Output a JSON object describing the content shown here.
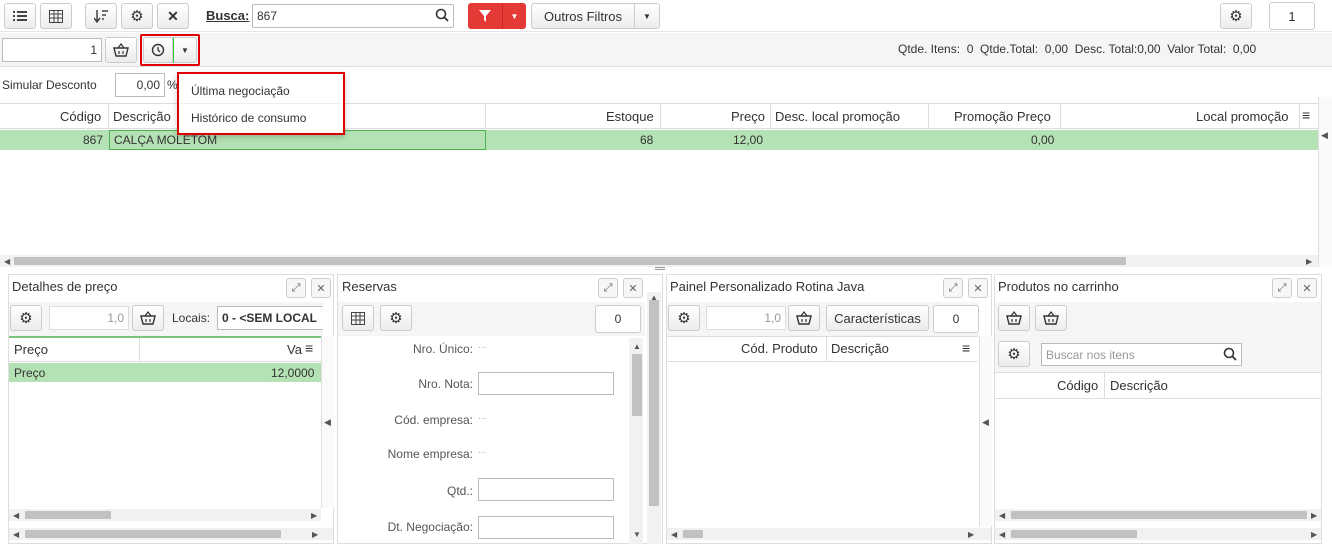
{
  "toolbar": {
    "search_label": "Busca:",
    "search_value": "867",
    "other_filters": "Outros Filtros",
    "page_number": "1",
    "quantity_value": "1"
  },
  "totals": {
    "text": "Qtde. Itens:  0  Qtde.Total:  0,00  Desc. Total:0,00  Valor Total:  0,00"
  },
  "discount": {
    "label": "Simular Desconto",
    "value": "0,00",
    "pct": "%"
  },
  "dropdown": {
    "items": [
      "Última negociação",
      "Histórico de consumo"
    ]
  },
  "grid": {
    "columns": [
      "Código",
      "Descrição",
      "Estoque",
      "Preço",
      "Desc. local promoção",
      "Promoção Preço",
      "Local promoção"
    ],
    "row": {
      "codigo": "867",
      "descricao": "CALÇA MOLETOM",
      "estoque": "68",
      "preco": "12,00",
      "desc_local": "",
      "promo_preco": "0,00",
      "local": ""
    }
  },
  "price_panel": {
    "title": "Detalhes de preço",
    "qty": "1,0",
    "locais_label": "Locais:",
    "locais_value": "0 - <SEM LOCAL",
    "col_preco": "Preço",
    "col_val": "Va",
    "row_label": "Preço",
    "row_value": "12,0000"
  },
  "reservas": {
    "title": "Reservas",
    "count": "0",
    "fields": [
      {
        "label": "Nro. Único:",
        "value": "..."
      },
      {
        "label": "Nro. Nota:",
        "value": ""
      },
      {
        "label": "Cód. empresa:",
        "value": "..."
      },
      {
        "label": "Nome empresa:",
        "value": "..."
      },
      {
        "label": "Qtd.:",
        "value": ""
      },
      {
        "label": "Dt. Negociação:",
        "value": ""
      }
    ]
  },
  "java_panel": {
    "title": "Painel Personalizado Rotina Java",
    "qty": "1,0",
    "caracteristicas": "Características",
    "count": "0",
    "col_codigo": "Cód. Produto",
    "col_descricao": "Descrição"
  },
  "cart_panel": {
    "title": "Produtos no carrinho",
    "search_placeholder": "Buscar nos itens",
    "col_codigo": "Código",
    "col_descricao": "Descrição"
  },
  "colors": {
    "accent_red": "#e53935",
    "row_green": "#b4e2b4",
    "highlight_border": "#e00000"
  }
}
